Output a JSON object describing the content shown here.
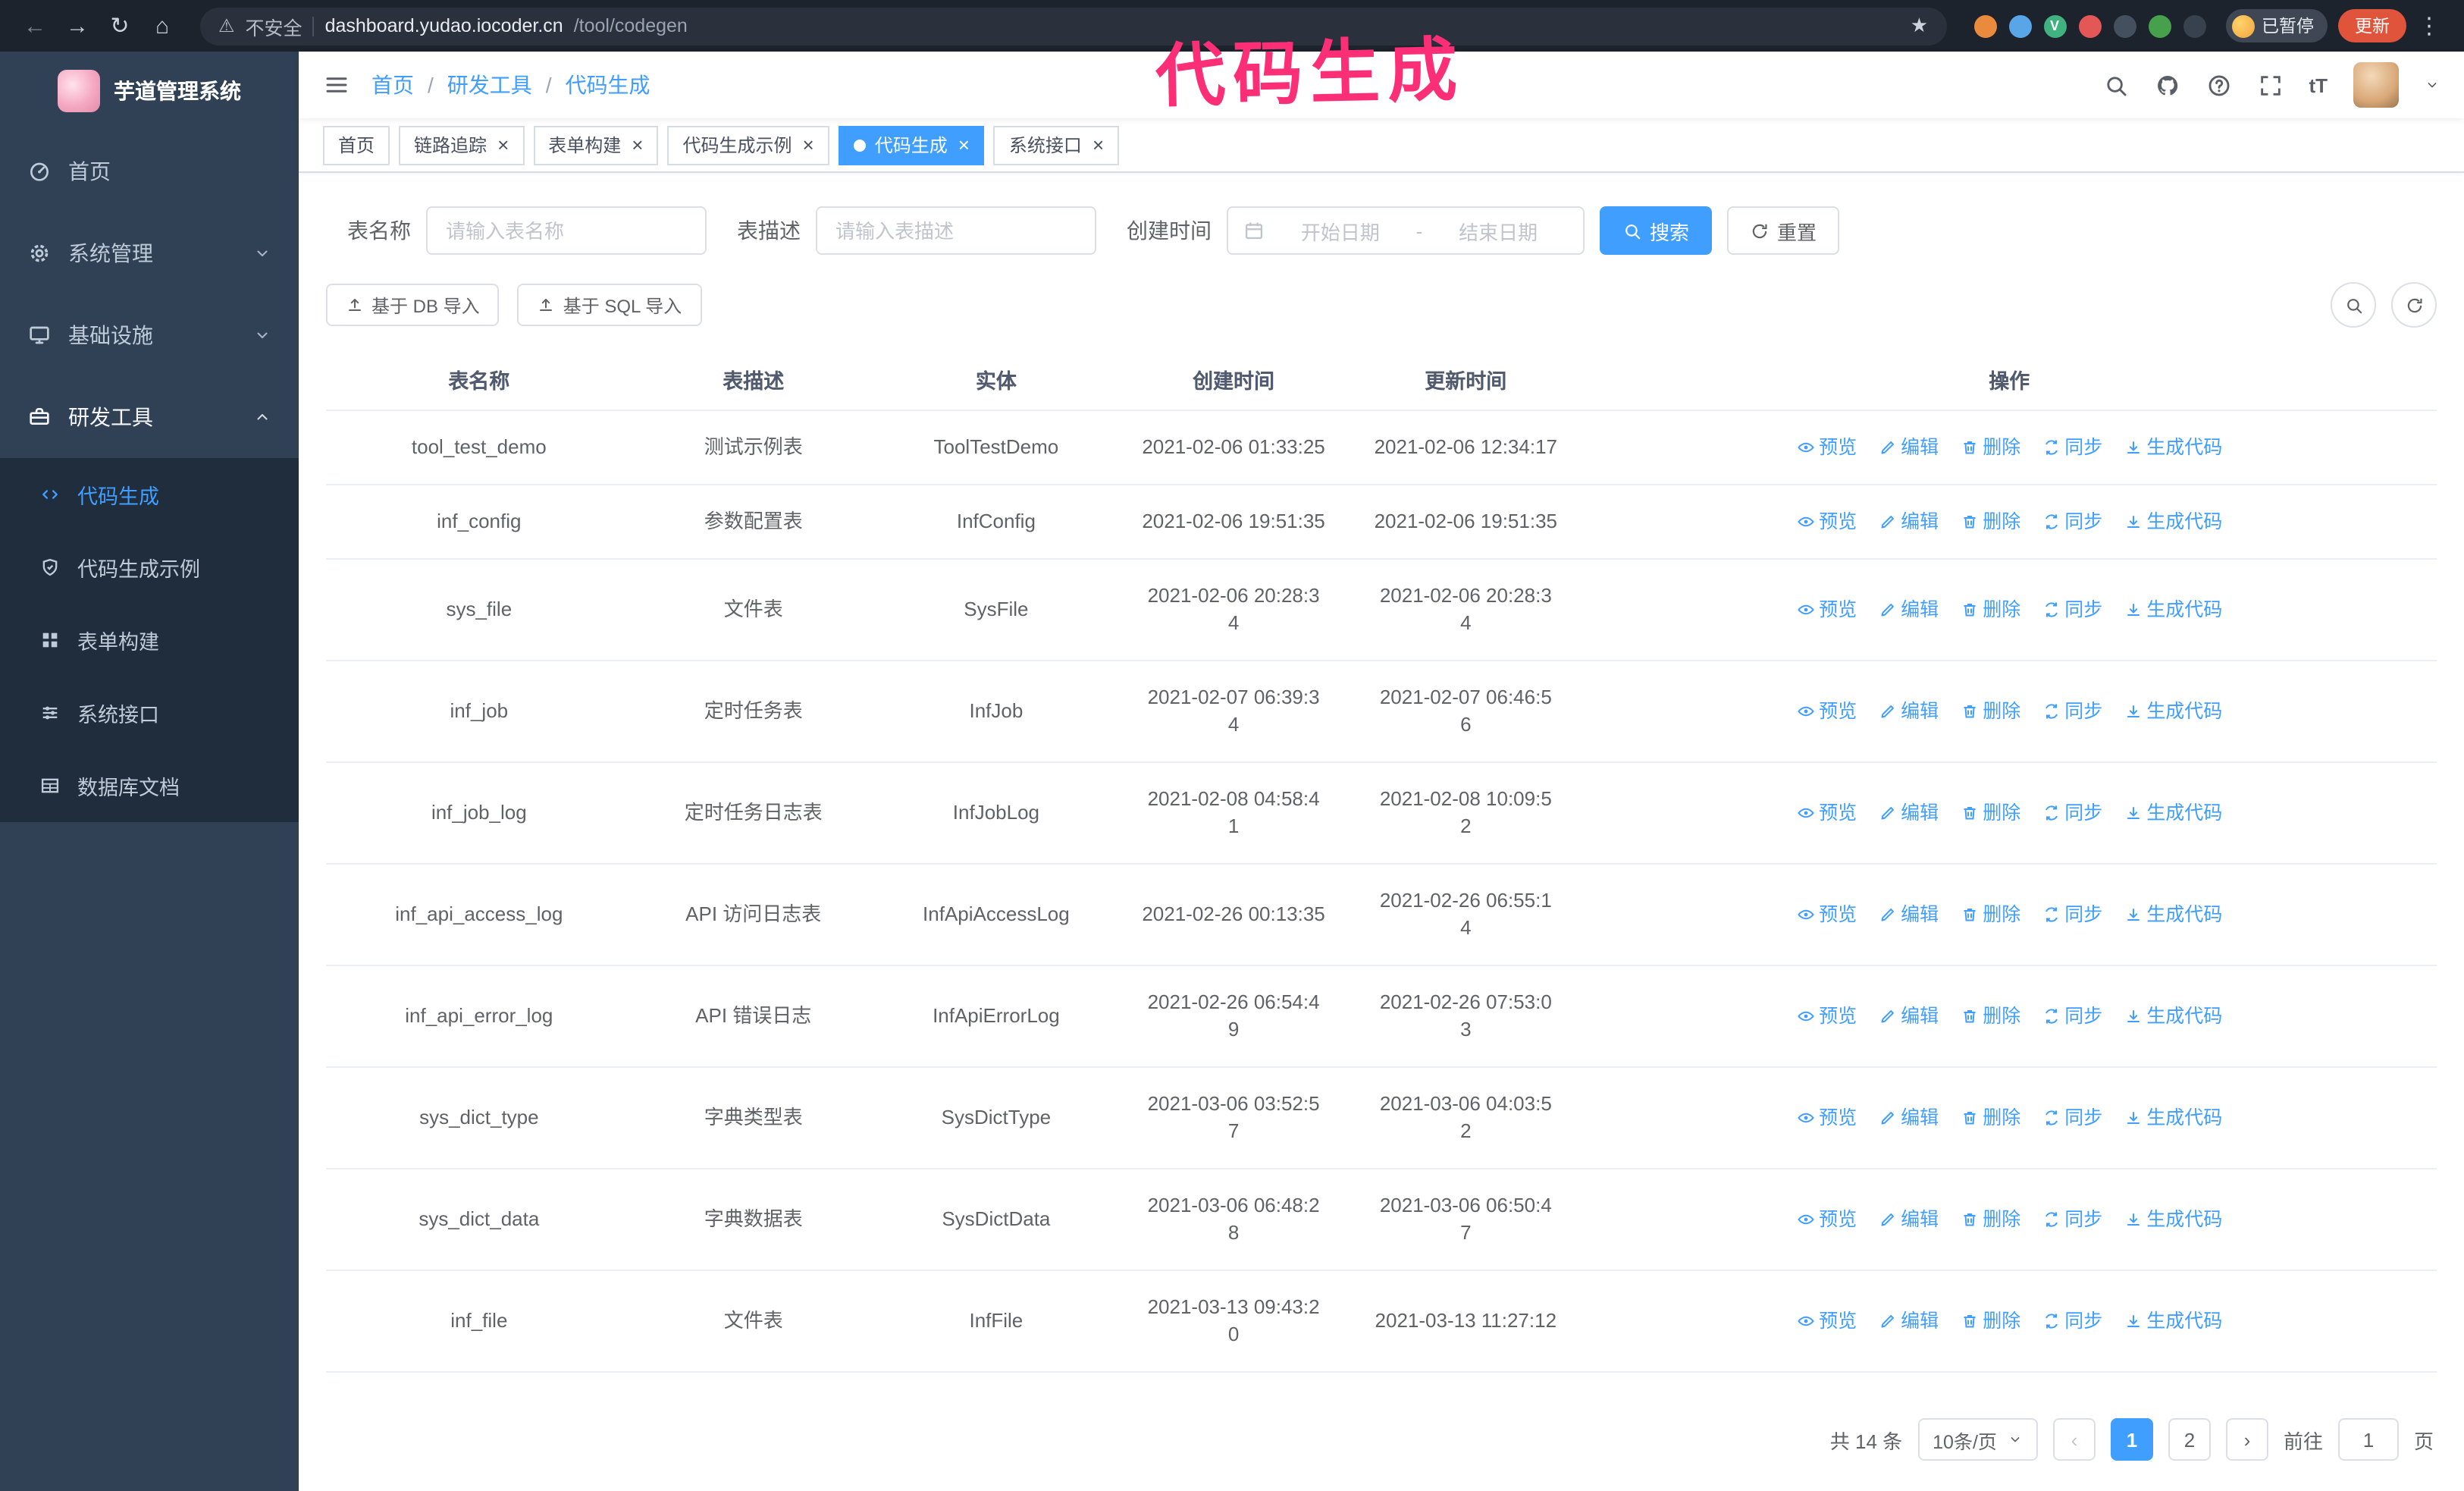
{
  "annotation": {
    "text": "代码生成",
    "color": "#fb2e76"
  },
  "colors": {
    "accent": "#409eff",
    "sidebar_bg": "#304156",
    "submenu_bg": "#1f2d3d",
    "update_button": "#e0543c",
    "annotation": "#fb2e76"
  },
  "browser": {
    "security_label": "不安全",
    "url_host": "dashboard.yudao.iocoder.cn",
    "url_path": "/tool/codegen",
    "paused_badge": "已暂停",
    "update_button": "更新"
  },
  "sidebar": {
    "app_title": "芋道管理系统",
    "items": [
      {
        "label": "首页"
      },
      {
        "label": "系统管理"
      },
      {
        "label": "基础设施"
      },
      {
        "label": "研发工具"
      }
    ],
    "subitems": [
      {
        "label": "代码生成"
      },
      {
        "label": "代码生成示例"
      },
      {
        "label": "表单构建"
      },
      {
        "label": "系统接口"
      },
      {
        "label": "数据库文档"
      }
    ]
  },
  "header": {
    "breadcrumb": [
      "首页",
      "研发工具",
      "代码生成"
    ],
    "separator": "/"
  },
  "tabs": [
    {
      "label": "首页",
      "closable": false,
      "active": false
    },
    {
      "label": "链路追踪",
      "closable": true,
      "active": false
    },
    {
      "label": "表单构建",
      "closable": true,
      "active": false
    },
    {
      "label": "代码生成示例",
      "closable": true,
      "active": false
    },
    {
      "label": "代码生成",
      "closable": true,
      "active": true
    },
    {
      "label": "系统接口",
      "closable": true,
      "active": false
    }
  ],
  "filters": {
    "name_label": "表名称",
    "name_placeholder": "请输入表名称",
    "desc_label": "表描述",
    "desc_placeholder": "请输入表描述",
    "time_label": "创建时间",
    "start_placeholder": "开始日期",
    "range_separator": "-",
    "end_placeholder": "结束日期",
    "search_button": "搜索",
    "reset_button": "重置"
  },
  "toolbar": {
    "import_db_button": "基于 DB 导入",
    "import_sql_button": "基于 SQL 导入"
  },
  "table": {
    "columns": [
      "表名称",
      "表描述",
      "实体",
      "创建时间",
      "更新时间",
      "操作"
    ],
    "row_actions": [
      {
        "label": "预览",
        "icon": "eye",
        "name": "preview-link"
      },
      {
        "label": "编辑",
        "icon": "edit",
        "name": "edit-link"
      },
      {
        "label": "删除",
        "icon": "trash",
        "name": "delete-link"
      },
      {
        "label": "同步",
        "icon": "sync",
        "name": "sync-link"
      },
      {
        "label": "生成代码",
        "icon": "download",
        "name": "generate-code-link"
      }
    ],
    "rows": [
      {
        "name": "tool_test_demo",
        "description": "测试示例表",
        "entity": "ToolTestDemo",
        "create_time": "2021-02-06 01:33:25",
        "update_time": "2021-02-06 12:34:17"
      },
      {
        "name": "inf_config",
        "description": "参数配置表",
        "entity": "InfConfig",
        "create_time": "2021-02-06 19:51:35",
        "update_time": "2021-02-06 19:51:35"
      },
      {
        "name": "sys_file",
        "description": "文件表",
        "entity": "SysFile",
        "create_time": "2021-02-06 20:28:3\n4",
        "update_time": "2021-02-06 20:28:3\n4"
      },
      {
        "name": "inf_job",
        "description": "定时任务表",
        "entity": "InfJob",
        "create_time": "2021-02-07 06:39:3\n4",
        "update_time": "2021-02-07 06:46:5\n6"
      },
      {
        "name": "inf_job_log",
        "description": "定时任务日志表",
        "entity": "InfJobLog",
        "create_time": "2021-02-08 04:58:4\n1",
        "update_time": "2021-02-08 10:09:5\n2"
      },
      {
        "name": "inf_api_access_log",
        "description": "API 访问日志表",
        "entity": "InfApiAccessLog",
        "create_time": "2021-02-26 00:13:35",
        "update_time": "2021-02-26 06:55:1\n4"
      },
      {
        "name": "inf_api_error_log",
        "description": "API 错误日志",
        "entity": "InfApiErrorLog",
        "create_time": "2021-02-26 06:54:4\n9",
        "update_time": "2021-02-26 07:53:0\n3"
      },
      {
        "name": "sys_dict_type",
        "description": "字典类型表",
        "entity": "SysDictType",
        "create_time": "2021-03-06 03:52:5\n7",
        "update_time": "2021-03-06 04:03:5\n2"
      },
      {
        "name": "sys_dict_data",
        "description": "字典数据表",
        "entity": "SysDictData",
        "create_time": "2021-03-06 06:48:2\n8",
        "update_time": "2021-03-06 06:50:4\n7"
      },
      {
        "name": "inf_file",
        "description": "文件表",
        "entity": "InfFile",
        "create_time": "2021-03-13 09:43:2\n0",
        "update_time": "2021-03-13 11:27:12"
      }
    ]
  },
  "pagination": {
    "total_text": "共 14 条",
    "page_size": "10条/页",
    "pages": [
      "1",
      "2"
    ],
    "active_page": "1",
    "goto_label": "前往",
    "goto_value": "1",
    "goto_suffix": "页"
  }
}
